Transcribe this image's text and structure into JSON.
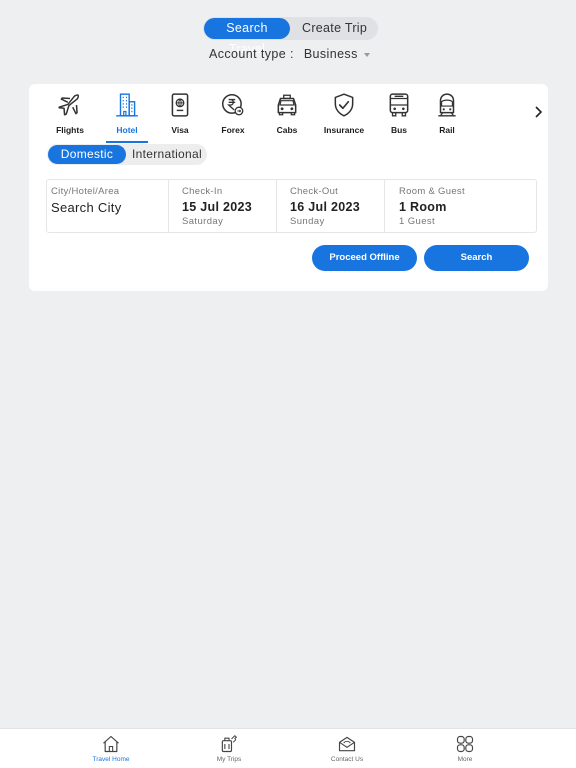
{
  "top_toggle": {
    "search_travel": "Search Travel",
    "create_trip": "Create Trip"
  },
  "account": {
    "label": "Account type :",
    "value": "Business"
  },
  "categories": [
    {
      "label": "Flights",
      "icon": "plane-icon"
    },
    {
      "label": "Hotel",
      "icon": "hotel-icon",
      "active": true
    },
    {
      "label": "Visa",
      "icon": "passport-icon"
    },
    {
      "label": "Forex",
      "icon": "forex-icon"
    },
    {
      "label": "Cabs",
      "icon": "taxi-icon"
    },
    {
      "label": "Insurance",
      "icon": "shield-check-icon"
    },
    {
      "label": "Bus",
      "icon": "bus-icon"
    },
    {
      "label": "Rail",
      "icon": "train-icon"
    }
  ],
  "region_toggle": {
    "domestic": "Domestic",
    "international": "International"
  },
  "fields": {
    "city": {
      "label": "City/Hotel/Area",
      "value": "Search City"
    },
    "checkin": {
      "label": "Check-In",
      "date": "15 Jul 2023",
      "day": "Saturday"
    },
    "checkout": {
      "label": "Check-Out",
      "date": "16 Jul 2023",
      "day": "Sunday"
    },
    "rooms": {
      "label": "Room & Guest",
      "value": "1 Room",
      "sub": "1 Guest"
    }
  },
  "buttons": {
    "offline": "Proceed Offline",
    "search": "Search"
  },
  "bottom_nav": [
    {
      "label": "Travel Home",
      "icon": "home-icon",
      "active": true
    },
    {
      "label": "My Trips",
      "icon": "luggage-icon"
    },
    {
      "label": "Contact Us",
      "icon": "envelope-icon"
    },
    {
      "label": "More",
      "icon": "grid-icon"
    }
  ],
  "colors": {
    "accent": "#1875e0",
    "background": "#eeeff1",
    "card": "#ffffff"
  }
}
